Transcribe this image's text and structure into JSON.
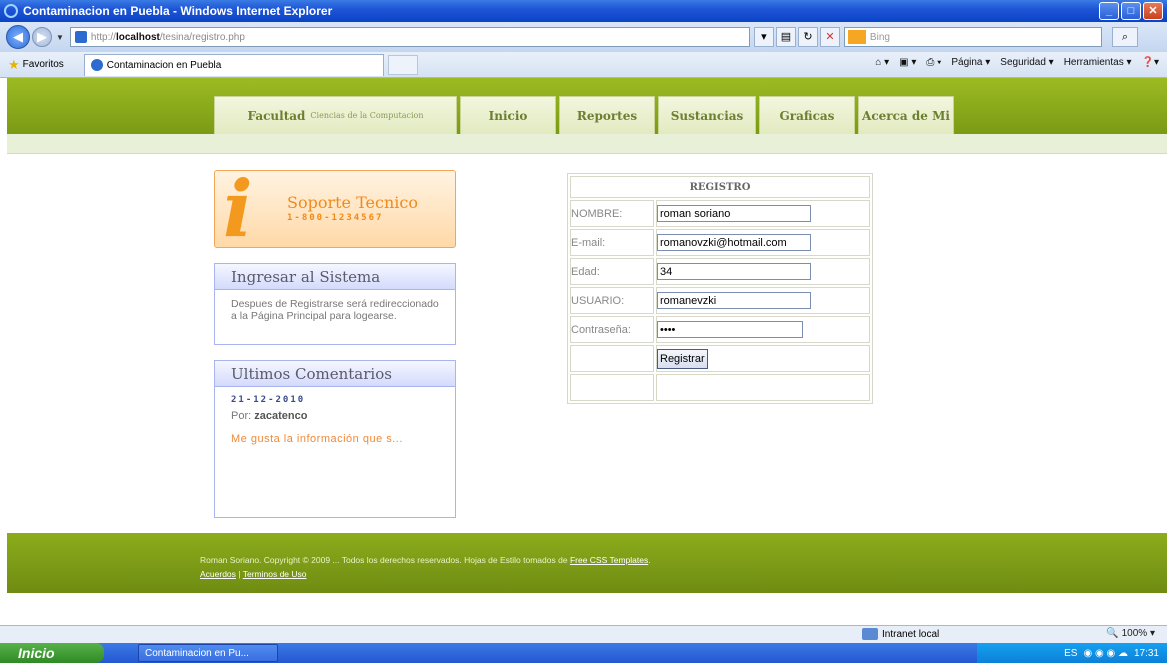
{
  "window": {
    "title": "Contaminacion en Puebla - Windows Internet Explorer",
    "minimize": "_",
    "maximize": "□",
    "close": "✕"
  },
  "address": {
    "url_prefix": "http://",
    "url_host": "localhost",
    "url_path": "/tesina/registro.php",
    "search_placeholder": "Bing"
  },
  "favorites": {
    "label": "Favoritos",
    "tab_title": "Contaminacion en Puebla"
  },
  "commandbar": {
    "page": "Página ▾",
    "security": "Seguridad ▾",
    "tools": "Herramientas ▾"
  },
  "nav": {
    "facultad": "Facultad",
    "facultad_sub": "Ciencias de la Computacion",
    "items": [
      "Inicio",
      "Reportes",
      "Sustancias",
      "Graficas",
      "Acerca de Mi"
    ]
  },
  "support": {
    "title": "Soporte Tecnico",
    "phone": "1-800-1234567"
  },
  "login_box": {
    "title": "Ingresar al Sistema",
    "text": "Despues de Registrarse será redireccionado a la Página Principal para logearse."
  },
  "comments_box": {
    "title": "Ultimos Comentarios",
    "date": "21-12-2010",
    "by_label": "Por:",
    "by_user": "zacatenco",
    "comment": "Me gusta la información que s..."
  },
  "registro": {
    "heading": "REGISTRO",
    "nombre_label": "NOMBRE:",
    "nombre_value": "roman soriano",
    "email_label": "E-mail:",
    "email_value": "romanovzki@hotmail.com",
    "edad_label": "Edad:",
    "edad_value": "34",
    "usuario_label": "USUARIO:",
    "usuario_value": "romanevzki",
    "password_label": "Contraseña:",
    "password_value": "••••",
    "submit_label": "Registrar"
  },
  "footer": {
    "text": "Roman Soriano. Copyright © 2009 ... Todos los derechos reservados. Hojas de Estilo tomados de",
    "link_templates": "Free CSS Templates",
    "link_acuerdos": "Acuerdos",
    "separator": "|",
    "link_terminos": "Terminos de Uso"
  },
  "status": {
    "zone": "Intranet local",
    "zoom": "100%"
  },
  "taskbar": {
    "start": "Inicio",
    "item": "Contaminacion en Pu...",
    "lang": "ES",
    "time": "17:31"
  }
}
